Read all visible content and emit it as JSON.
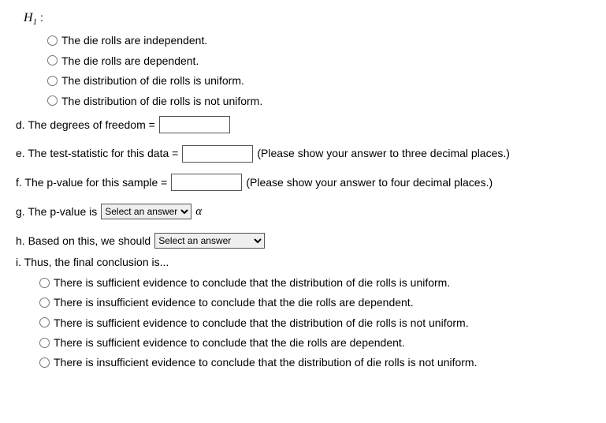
{
  "h1": {
    "label_html": "H",
    "sub": "1",
    "colon": ":",
    "options": [
      "The die rolls are independent.",
      "The die rolls are dependent.",
      "The distribution of die rolls is uniform.",
      "The distribution of die rolls is not uniform."
    ]
  },
  "d": {
    "label": "d. The degrees of freedom ="
  },
  "e": {
    "label": "e. The test-statistic for this data =",
    "hint": "(Please show your answer to three decimal places.)"
  },
  "f": {
    "label": "f. The p-value for this sample =",
    "hint": "(Please show your answer to four decimal places.)"
  },
  "g": {
    "label": "g. The p-value is",
    "select_placeholder": "Select an answer",
    "alpha": "α"
  },
  "h": {
    "label": "h. Based on this, we should",
    "select_placeholder": "Select an answer"
  },
  "i": {
    "label": "i. Thus, the final conclusion is...",
    "options": [
      "There is sufficient evidence to conclude that the distribution of die rolls is uniform.",
      "There is insufficient evidence to conclude that the die rolls are dependent.",
      "There is sufficient evidence to conclude that the distribution of die rolls is not uniform.",
      "There is sufficient evidence to conclude that the die rolls are dependent.",
      "There is insufficient evidence to conclude that the distribution of die rolls is not uniform."
    ]
  }
}
